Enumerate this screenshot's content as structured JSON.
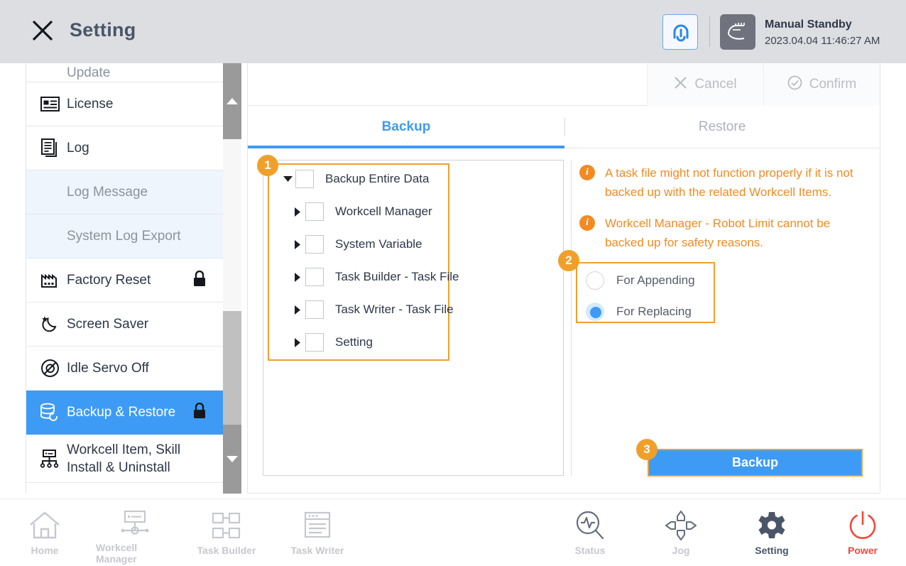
{
  "header": {
    "close_icon": "close-icon",
    "title": "Setting",
    "home_icon": "robot-home-icon",
    "state_icon": "manual-hand-icon",
    "state_name": "Manual Standby",
    "state_time": "2023.04.04 11:46:27 AM"
  },
  "sidebar": {
    "items": [
      {
        "label": "Update",
        "icon": "update-icon",
        "kind": "partial",
        "locked": false
      },
      {
        "label": "License",
        "icon": "license-card-icon",
        "kind": "normal",
        "locked": false
      },
      {
        "label": "Log",
        "icon": "log-document-icon",
        "kind": "normal",
        "locked": false
      },
      {
        "label": "Log Message",
        "icon": "none",
        "kind": "sub",
        "locked": false
      },
      {
        "label": "System Log Export",
        "icon": "none",
        "kind": "sub",
        "locked": false
      },
      {
        "label": "Factory Reset",
        "icon": "factory-icon",
        "kind": "normal",
        "locked": true
      },
      {
        "label": "Screen Saver",
        "icon": "moon-star-icon",
        "kind": "normal",
        "locked": false
      },
      {
        "label": "Idle Servo Off",
        "icon": "servo-off-icon",
        "kind": "normal",
        "locked": false
      },
      {
        "label": "Backup & Restore",
        "icon": "database-restore-icon",
        "kind": "active",
        "locked": true
      },
      {
        "label": "Workcell Item, Skill\nInstall & Uninstall",
        "icon": "workcell-item-icon",
        "kind": "tall",
        "locked": false
      }
    ],
    "scrollbar": {
      "up_arrow": "scroll-up-arrow-icon",
      "down_arrow": "scroll-down-arrow-icon"
    }
  },
  "toolbar": {
    "cancel_label": "Cancel",
    "cancel_icon": "x-icon",
    "confirm_label": "Confirm",
    "confirm_icon": "check-circle-icon"
  },
  "tabs": {
    "backup": "Backup",
    "restore": "Restore",
    "active": "Backup"
  },
  "tree": {
    "rows": [
      {
        "label": "Backup Entire Data",
        "indent": 0,
        "arrow": "down",
        "checked": false
      },
      {
        "label": "Workcell Manager",
        "indent": 1,
        "arrow": "right",
        "checked": false
      },
      {
        "label": "System Variable",
        "indent": 1,
        "arrow": "right",
        "checked": false
      },
      {
        "label": "Task Builder - Task File",
        "indent": 1,
        "arrow": "right",
        "checked": false
      },
      {
        "label": "Task Writer - Task File",
        "indent": 1,
        "arrow": "right",
        "checked": false
      },
      {
        "label": "Setting",
        "indent": 1,
        "arrow": "right",
        "checked": false
      }
    ]
  },
  "notes": [
    "A task file might not function properly if it is not backed up with the related Workcell Items.",
    "Workcell Manager - Robot Limit cannot be backed up for safety reasons."
  ],
  "radio": {
    "options": [
      {
        "label": "For Appending",
        "selected": false
      },
      {
        "label": "For Replacing",
        "selected": true
      }
    ]
  },
  "backup_button": {
    "label": "Backup"
  },
  "badges": {
    "one": "1",
    "two": "2",
    "three": "3"
  },
  "bottom_nav": {
    "items": [
      {
        "label": "Home",
        "icon": "home-icon",
        "state": "inactive"
      },
      {
        "label": "Workcell Manager",
        "icon": "workcell-manager-icon",
        "state": "inactive"
      },
      {
        "label": "Task Builder",
        "icon": "task-builder-icon",
        "state": "inactive"
      },
      {
        "label": "Task Writer",
        "icon": "task-writer-icon",
        "state": "inactive"
      },
      {
        "label": "Status",
        "icon": "status-scope-icon",
        "state": "inactive"
      },
      {
        "label": "Jog",
        "icon": "jog-arrows-icon",
        "state": "inactive"
      },
      {
        "label": "Setting",
        "icon": "gear-icon",
        "state": "active"
      },
      {
        "label": "Power",
        "icon": "power-icon",
        "state": "power"
      }
    ]
  },
  "colors": {
    "accent_blue": "#3d9bf5",
    "highlight_orange": "#f0a02a",
    "note_orange": "#f28b24",
    "power_red": "#f4483c",
    "header_bg": "#dddee2"
  }
}
